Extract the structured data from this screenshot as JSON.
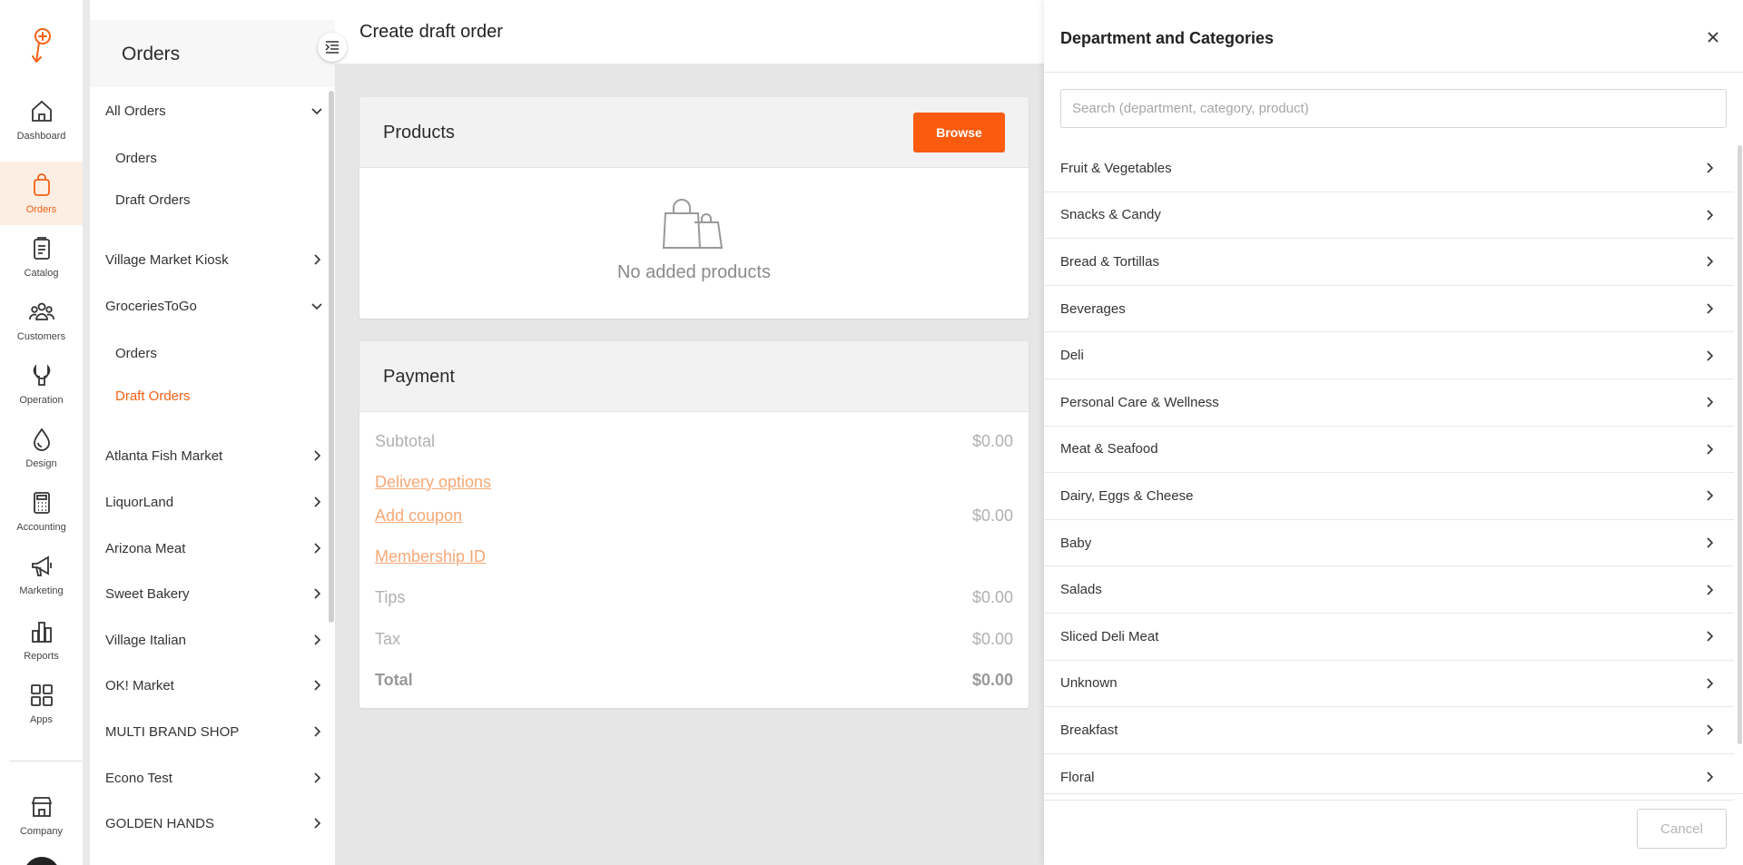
{
  "rail": {
    "items": [
      {
        "label": "Dashboard",
        "icon": "home-icon"
      },
      {
        "label": "Orders",
        "icon": "shopping-bag-icon",
        "active": true
      },
      {
        "label": "Catalog",
        "icon": "clipboard-icon"
      },
      {
        "label": "Customers",
        "icon": "users-icon"
      },
      {
        "label": "Operation",
        "icon": "wrench-icon"
      },
      {
        "label": "Design",
        "icon": "droplet-icon"
      },
      {
        "label": "Accounting",
        "icon": "calculator-icon"
      },
      {
        "label": "Marketing",
        "icon": "megaphone-icon"
      },
      {
        "label": "Reports",
        "icon": "bar-chart-icon"
      },
      {
        "label": "Apps",
        "icon": "grid-icon"
      }
    ],
    "company_label": "Company"
  },
  "subnav": {
    "title": "Orders",
    "groups": [
      {
        "label": "All Orders",
        "expanded": true,
        "children": [
          "Orders",
          "Draft Orders"
        ]
      },
      {
        "label": "Village Market Kiosk"
      },
      {
        "label": "GroceriesToGo",
        "expanded": true,
        "children": [
          "Orders",
          "Draft Orders"
        ],
        "active_child": "Draft Orders"
      },
      {
        "label": "Atlanta Fish Market"
      },
      {
        "label": "LiquorLand"
      },
      {
        "label": "Arizona Meat"
      },
      {
        "label": "Sweet Bakery"
      },
      {
        "label": "Village Italian"
      },
      {
        "label": "OK! Market"
      },
      {
        "label": "MULTI BRAND SHOP"
      },
      {
        "label": "Econo Test"
      },
      {
        "label": "GOLDEN HANDS"
      }
    ]
  },
  "main": {
    "title": "Create draft order",
    "products": {
      "title": "Products",
      "browse_label": "Browse",
      "empty_text": "No added products"
    },
    "payment": {
      "title": "Payment",
      "subtotal_label": "Subtotal",
      "subtotal_value": "$0.00",
      "delivery_label": "Delivery options",
      "coupon_label": "Add coupon",
      "coupon_value": "$0.00",
      "membership_label": "Membership ID",
      "tips_label": "Tips",
      "tips_value": "$0.00",
      "tax_label": "Tax",
      "tax_value": "$0.00",
      "total_label": "Total",
      "total_value": "$0.00"
    }
  },
  "panel": {
    "title": "Department and Categories",
    "search_placeholder": "Search (department, category, product)",
    "categories": [
      "Fruit & Vegetables",
      "Snacks & Candy",
      "Bread & Tortillas",
      "Beverages",
      "Deli",
      "Personal Care & Wellness",
      "Meat & Seafood",
      "Dairy, Eggs & Cheese",
      "Baby",
      "Salads",
      "Sliced Deli Meat",
      "Unknown",
      "Breakfast",
      "Floral"
    ],
    "cancel_label": "Cancel"
  },
  "colors": {
    "accent": "#fa5b0f",
    "active_bg": "#fdeee4",
    "link_muted": "#f7a876"
  }
}
